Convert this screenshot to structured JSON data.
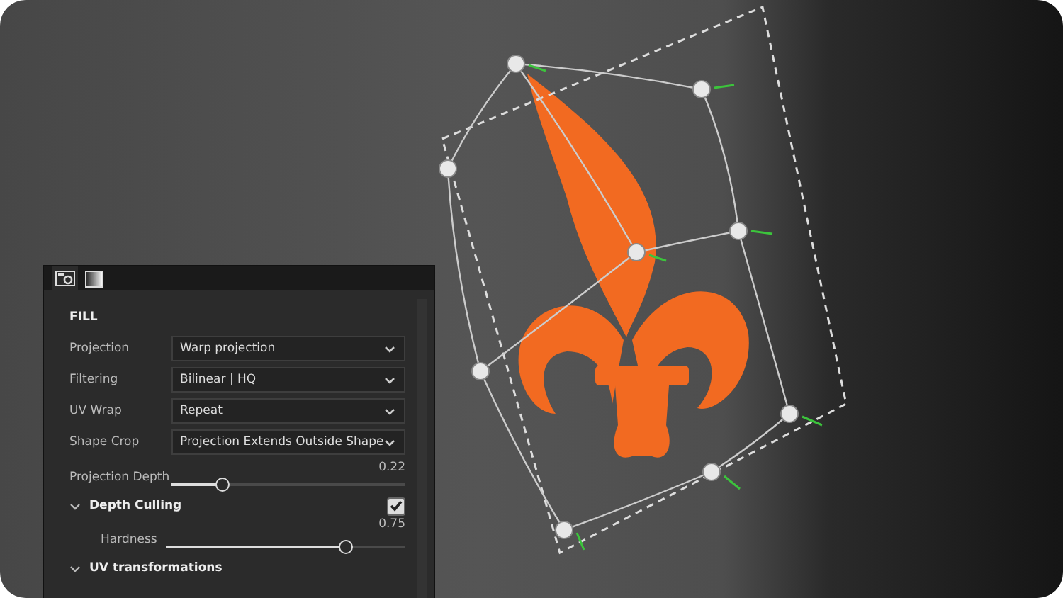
{
  "panel": {
    "tabs": [
      {
        "kind": "camera",
        "selected": true
      },
      {
        "kind": "gradient",
        "selected": false
      }
    ],
    "section_title": "FILL",
    "fields": [
      {
        "label": "Projection",
        "value": "Warp projection"
      },
      {
        "label": "Filtering",
        "value": "Bilinear | HQ"
      },
      {
        "label": "UV Wrap",
        "value": "Repeat"
      },
      {
        "label": "Shape Crop",
        "value": "Projection Extends Outside Shape"
      }
    ],
    "projection_depth": {
      "label": "Projection Depth",
      "reading": "0.22",
      "level": 0.22
    },
    "depth_culling": {
      "label": "Depth Culling",
      "expanded": true,
      "checked": true,
      "hardness": {
        "label": "Hardness",
        "reading": "0.75",
        "level": 0.75
      }
    },
    "uv_transformations": {
      "label": "UV transformations",
      "expanded": true
    }
  }
}
